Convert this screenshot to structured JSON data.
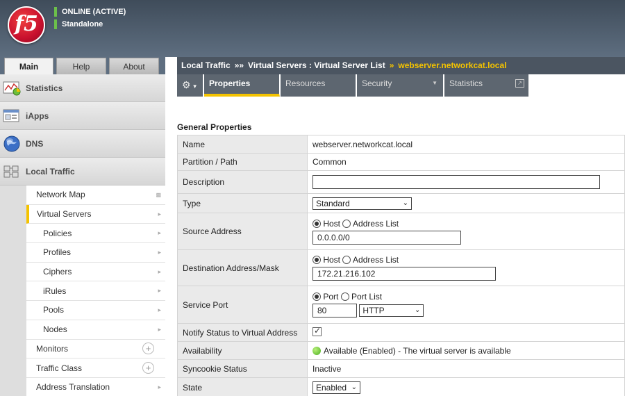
{
  "header": {
    "logo_text": "f5",
    "status": "ONLINE (ACTIVE)",
    "mode": "Standalone",
    "status_color": "#6cc04a"
  },
  "main_tabs": [
    {
      "label": "Main",
      "active": true
    },
    {
      "label": "Help"
    },
    {
      "label": "About"
    }
  ],
  "nav": {
    "categories": [
      {
        "label": "Statistics",
        "icon": "statistics-icon"
      },
      {
        "label": "iApps",
        "icon": "iapps-icon"
      },
      {
        "label": "DNS",
        "icon": "globe-icon"
      },
      {
        "label": "Local Traffic",
        "icon": "local-traffic-icon"
      }
    ],
    "items": [
      {
        "label": "Network Map"
      },
      {
        "label": "Virtual Servers",
        "selected": true
      },
      {
        "label": "Policies"
      },
      {
        "label": "Profiles"
      },
      {
        "label": "Ciphers"
      },
      {
        "label": "iRules"
      },
      {
        "label": "Pools"
      },
      {
        "label": "Nodes"
      },
      {
        "label": "Monitors"
      },
      {
        "label": "Traffic Class"
      },
      {
        "label": "Address Translation"
      }
    ]
  },
  "breadcrumb": {
    "part1": "Local Traffic",
    "sep1": "»»",
    "part2": "Virtual Servers : Virtual Server List",
    "sep2": "»",
    "current": "webserver.networkcat.local",
    "accent": "#f4c300"
  },
  "tabs": [
    {
      "label": "Properties",
      "active": true
    },
    {
      "label": "Resources"
    },
    {
      "label": "Security"
    },
    {
      "label": "Statistics"
    }
  ],
  "section_title": "General Properties",
  "props": {
    "name_label": "Name",
    "name_value": "webserver.networkcat.local",
    "partition_label": "Partition / Path",
    "partition_value": "Common",
    "description_label": "Description",
    "description_value": "",
    "type_label": "Type",
    "type_value": "Standard",
    "source_label": "Source Address",
    "source_opt_host": "Host",
    "source_opt_list": "Address List",
    "source_value": "0.0.0.0/0",
    "dest_label": "Destination Address/Mask",
    "dest_opt_host": "Host",
    "dest_opt_list": "Address List",
    "dest_value": "172.21.216.102",
    "port_label": "Service Port",
    "port_opt_port": "Port",
    "port_opt_list": "Port List",
    "port_value": "80",
    "port_protocol": "HTTP",
    "notify_label": "Notify Status to Virtual Address",
    "availability_label": "Availability",
    "availability_value": "Available (Enabled) - The virtual server is available",
    "syncookie_label": "Syncookie Status",
    "syncookie_value": "Inactive",
    "state_label": "State",
    "state_value": "Enabled"
  }
}
